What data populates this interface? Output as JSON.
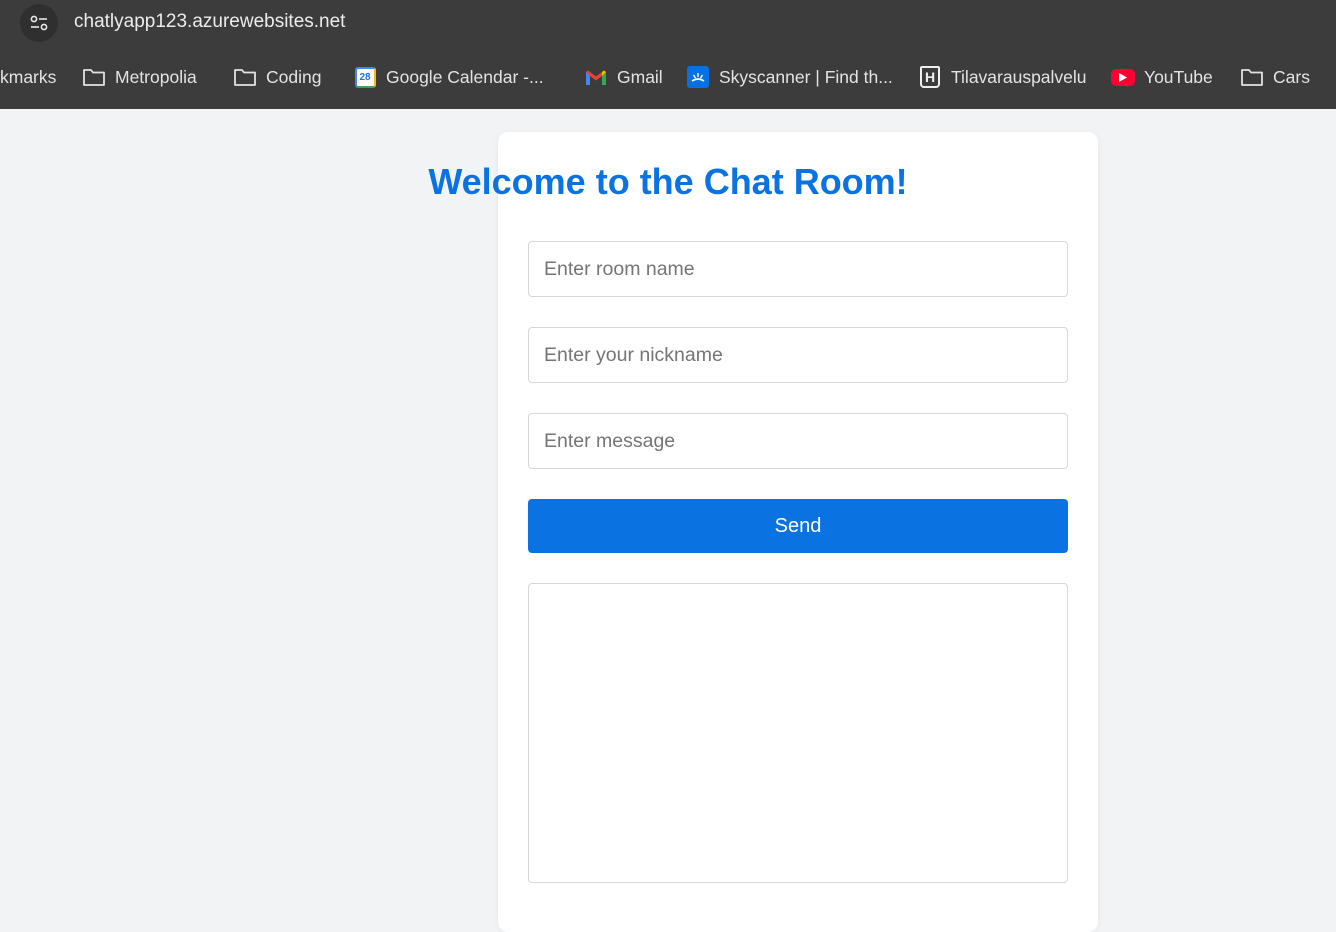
{
  "browser": {
    "url": "chatlyapp123.azurewebsites.net",
    "bookmarks": [
      {
        "label": "kmarks",
        "icon": "folder-icon"
      },
      {
        "label": "Metropolia",
        "icon": "folder-icon"
      },
      {
        "label": "Coding",
        "icon": "folder-icon"
      },
      {
        "label": "Google Calendar -...",
        "icon": "google-calendar-icon",
        "icon_text": "28"
      },
      {
        "label": "Gmail",
        "icon": "gmail-icon"
      },
      {
        "label": "Skyscanner | Find th...",
        "icon": "skyscanner-icon"
      },
      {
        "label": "Tilavarauspalvelu",
        "icon": "tilavaraus-icon",
        "icon_text": "H"
      },
      {
        "label": "YouTube",
        "icon": "youtube-icon"
      },
      {
        "label": "Cars",
        "icon": "folder-icon"
      }
    ]
  },
  "chat": {
    "title": "Welcome to the Chat Room!",
    "room_placeholder": "Enter room name",
    "nickname_placeholder": "Enter your nickname",
    "message_placeholder": "Enter message",
    "send_label": "Send",
    "room_value": "",
    "nickname_value": "",
    "message_value": ""
  },
  "colors": {
    "accent": "#0a73e1",
    "chrome_bg": "#3c3c3c",
    "page_bg": "#f2f3f5"
  }
}
